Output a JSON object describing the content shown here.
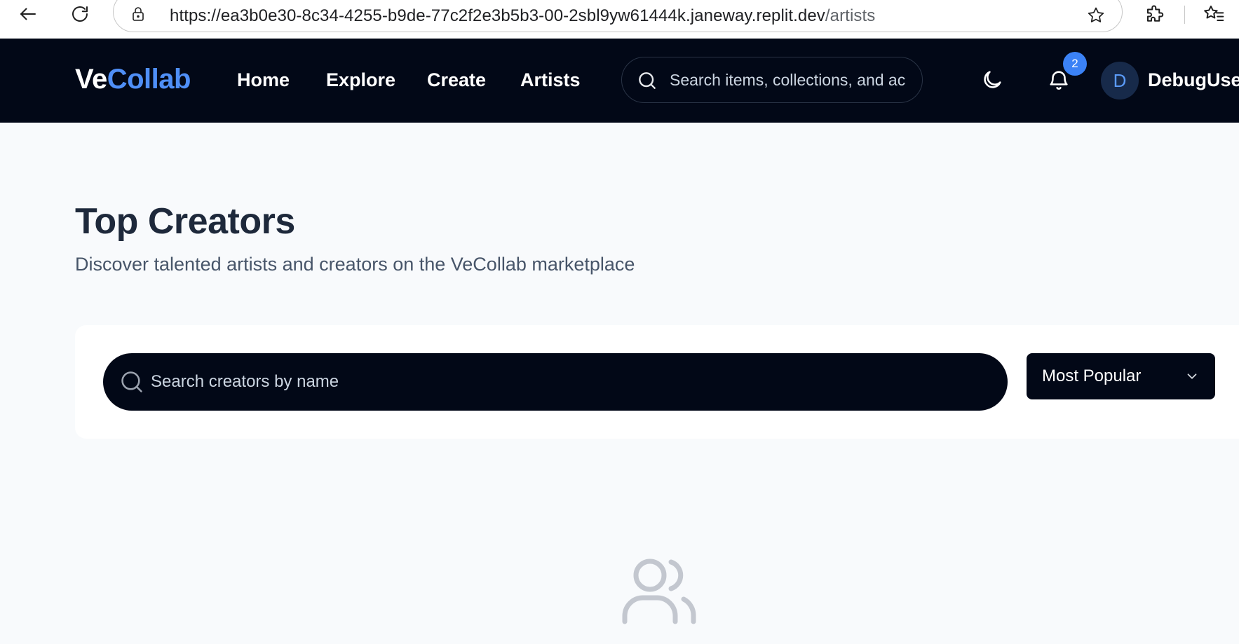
{
  "browser": {
    "url_main": "https://ea3b0e30-8c34-4255-b9de-77c2f2e3b5b3-00-2sbl9yw61444k.janeway.replit.dev",
    "url_path": "/artists"
  },
  "header": {
    "logo_part1": "Ve",
    "logo_part2": "Collab",
    "nav": {
      "home": "Home",
      "explore": "Explore",
      "create": "Create",
      "artists": "Artists"
    },
    "search_placeholder": "Search items, collections, and ac",
    "notification_count": "2",
    "avatar_initial": "D",
    "username": "DebugUser"
  },
  "main": {
    "title": "Top Creators",
    "subtitle": "Discover talented artists and creators on the VeCollab marketplace",
    "creator_search_placeholder": "Search creators by name",
    "sort_selected": "Most Popular"
  },
  "icons": {
    "back": "arrow-left-icon",
    "reload": "reload-icon",
    "lock": "lock-icon",
    "star": "star-icon",
    "extensions": "puzzle-icon",
    "favorites": "favorites-icon",
    "search": "search-icon",
    "theme": "moon-icon",
    "notifications": "bell-icon",
    "sort": "chevron-down-icon",
    "empty_state": "users-icon"
  },
  "colors": {
    "header_bg": "#020817",
    "accent": "#4f8ff7",
    "badge": "#3b82f6",
    "page_bg": "#f8fafc",
    "title_text": "#1e293b"
  }
}
